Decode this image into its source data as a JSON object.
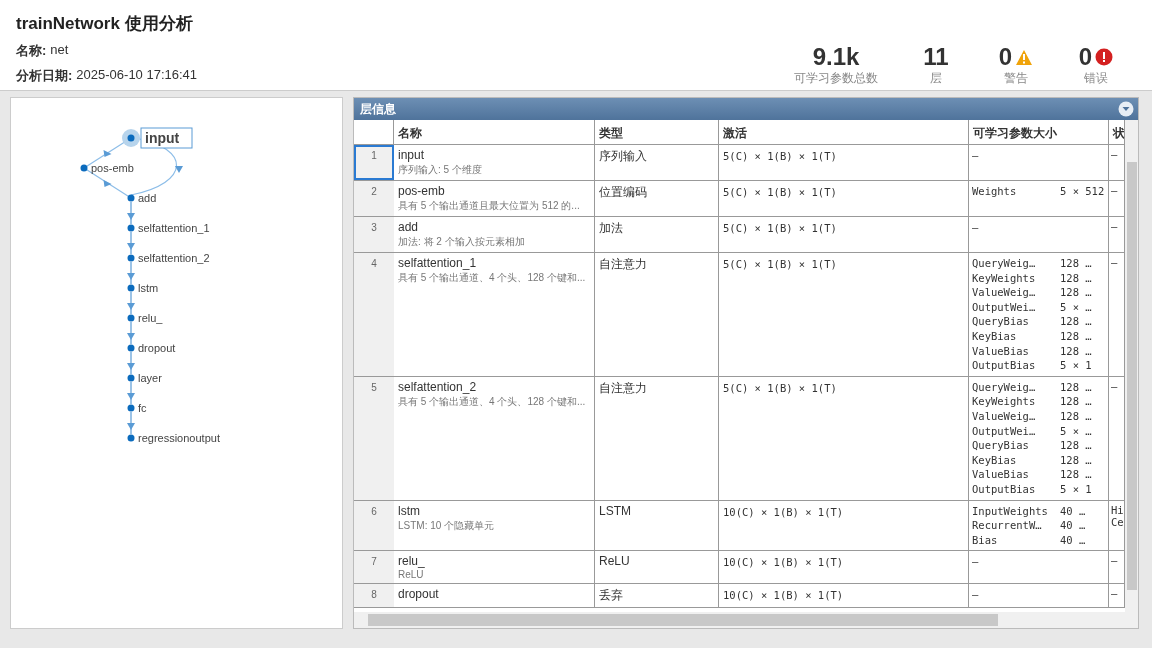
{
  "header": {
    "title": "trainNetwork 使用分析",
    "fields": [
      {
        "label": "名称:",
        "value": "net"
      },
      {
        "label": "分析日期:",
        "value": "2025-06-10 17:16:41"
      }
    ],
    "stats": [
      {
        "value": "9.1k",
        "label": "可学习参数总数",
        "kind": "plain"
      },
      {
        "value": "11",
        "label": "层",
        "kind": "plain"
      },
      {
        "value": "0",
        "label": "警告",
        "kind": "warning"
      },
      {
        "value": "0",
        "label": "错误",
        "kind": "error"
      }
    ]
  },
  "graph": {
    "nodes": [
      {
        "label": "input",
        "kind": "main",
        "selected": true
      },
      {
        "label": "pos-emb",
        "kind": "branch",
        "selected": false
      },
      {
        "label": "add",
        "kind": "main",
        "selected": false
      },
      {
        "label": "selfattention_1",
        "kind": "main",
        "selected": false
      },
      {
        "label": "selfattention_2",
        "kind": "main",
        "selected": false
      },
      {
        "label": "lstm",
        "kind": "main",
        "selected": false
      },
      {
        "label": "relu_",
        "kind": "main",
        "selected": false
      },
      {
        "label": "dropout",
        "kind": "main",
        "selected": false
      },
      {
        "label": "layer",
        "kind": "main",
        "selected": false
      },
      {
        "label": "fc",
        "kind": "main",
        "selected": false
      },
      {
        "label": "regressionoutput",
        "kind": "main",
        "selected": false
      }
    ]
  },
  "table": {
    "title": "层信息",
    "columns": [
      "名称",
      "类型",
      "激活",
      "可学习参数大小",
      "状"
    ],
    "rows": [
      {
        "index": "1",
        "name": "input",
        "description": "序列输入: 5 个维度",
        "type": "序列输入",
        "activation": "5(C) × 1(B) × 1(T)",
        "params": [
          [
            "–"
          ]
        ],
        "column_6": [
          "–"
        ],
        "selected": true
      },
      {
        "index": "2",
        "name": "pos-emb",
        "description": "具有 5 个输出通道且最大位置为 512 的...",
        "type": "位置编码",
        "activation": "5(C) × 1(B) × 1(T)",
        "params": [
          [
            "Weights",
            "5 × 512"
          ]
        ],
        "column_6": [
          "–"
        ],
        "selected": false
      },
      {
        "index": "3",
        "name": "add",
        "description": "加法: 将 2 个输入按元素相加",
        "type": "加法",
        "activation": "5(C) × 1(B) × 1(T)",
        "params": [
          [
            "–"
          ]
        ],
        "column_6": [
          "–"
        ],
        "selected": false
      },
      {
        "index": "4",
        "name": "selfattention_1",
        "description": "具有 5 个输出通道、4 个头、128 个键和...",
        "type": "自注意力",
        "activation": "5(C) × 1(B) × 1(T)",
        "params": [
          [
            "QueryWeig…",
            "128 …"
          ],
          [
            "KeyWeights",
            "128 …"
          ],
          [
            "ValueWeig…",
            "128 …"
          ],
          [
            "OutputWei…",
            "5 × …"
          ],
          [
            "QueryBias",
            "128 …"
          ],
          [
            "KeyBias",
            "128 …"
          ],
          [
            "ValueBias",
            "128 …"
          ],
          [
            "OutputBias",
            "5 × 1"
          ]
        ],
        "column_6": [
          "–"
        ],
        "selected": false
      },
      {
        "index": "5",
        "name": "selfattention_2",
        "description": "具有 5 个输出通道、4 个头、128 个键和...",
        "type": "自注意力",
        "activation": "5(C) × 1(B) × 1(T)",
        "params": [
          [
            "QueryWeig…",
            "128 …"
          ],
          [
            "KeyWeights",
            "128 …"
          ],
          [
            "ValueWeig…",
            "128 …"
          ],
          [
            "OutputWei…",
            "5 × …"
          ],
          [
            "QueryBias",
            "128 …"
          ],
          [
            "KeyBias",
            "128 …"
          ],
          [
            "ValueBias",
            "128 …"
          ],
          [
            "OutputBias",
            "5 × 1"
          ]
        ],
        "column_6": [
          "–"
        ],
        "selected": false
      },
      {
        "index": "6",
        "name": "lstm",
        "description": "LSTM: 10 个隐藏单元",
        "type": "LSTM",
        "activation": "10(C) × 1(B) × 1(T)",
        "params": [
          [
            "InputWeights",
            "40 …"
          ],
          [
            "RecurrentW…",
            "40 …"
          ],
          [
            "Bias",
            "40 …"
          ]
        ],
        "column_6": [
          "Hi",
          "Ce"
        ],
        "selected": false
      },
      {
        "index": "7",
        "name": "relu_",
        "description": "ReLU",
        "type": "ReLU",
        "activation": "10(C) × 1(B) × 1(T)",
        "params": [
          [
            "–"
          ]
        ],
        "column_6": [
          "–"
        ],
        "selected": false
      },
      {
        "index": "8",
        "name": "dropout",
        "type": "丢弃",
        "activation": "10(C) × 1(B) × 1(T)",
        "params": [
          [
            "–"
          ]
        ],
        "column_6": [
          "–"
        ],
        "selected": false
      }
    ]
  }
}
